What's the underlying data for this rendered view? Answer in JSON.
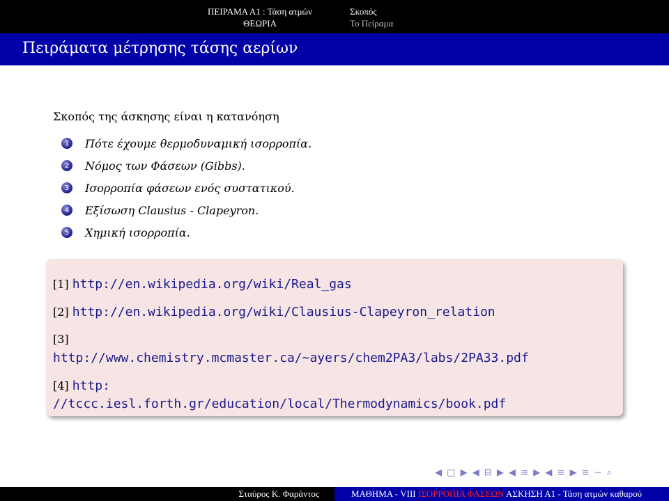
{
  "header": {
    "section_title": "ΠΕΙΡΑΜΑ Α1 : Τάση ατμών",
    "section_subtitle": "ΘΕΩΡΙΑ",
    "subsection_title": "Σκοπός",
    "subsection_subtitle": "Το Πείραμα"
  },
  "frame": {
    "title": "Πειράματα μέτρησης τάσης αερίων"
  },
  "content": {
    "intro": "Σκοπός της άσκησης είναι η κατανόηση",
    "items": [
      {
        "num": "1",
        "text": "Πότε έχουμε θερμοδυναμική ισορροπία."
      },
      {
        "num": "2",
        "text": "Νόμος των Φάσεων (Gibbs)."
      },
      {
        "num": "3",
        "text": "Ισορροπία φάσεων ενός συστατικού."
      },
      {
        "num": "4",
        "text": "Εξίσωση Clausius - Clapeyron."
      },
      {
        "num": "5",
        "text": "Χημική ισορροπία."
      }
    ]
  },
  "references": [
    {
      "label": "[1]",
      "url": "http://en.wikipedia.org/wiki/Real_gas"
    },
    {
      "label": "[2]",
      "url": "http://en.wikipedia.org/wiki/Clausius-Clapeyron_relation"
    },
    {
      "label": "[3]",
      "url": "http://www.chemistry.mcmaster.ca/~ayers/chem2PA3/labs/2PA33.pdf"
    },
    {
      "label": "[4]",
      "url_part1": "http:",
      "url_part2": "//tccc.iesl.forth.gr/education/local/Thermodynamics/book.pdf"
    }
  ],
  "navigation": {
    "prev": "◀",
    "next": "▶",
    "frame_icon": "□",
    "subsection_icon": "⊟",
    "section_icon": "≡",
    "zoom_icon": "∽",
    "search_icon": "⌕"
  },
  "footer": {
    "author": "Σταύρος Κ. Φαράντος",
    "course": "ΜΑΘΗΜΑ - VIII",
    "topic": "ΙΣΟΡΡΟΠΙΑ ΦΑΣΕΩΝ",
    "exercise": "ΑΣΚΗΣΗ Α1 - Τάση ατμών καθαρού"
  },
  "colors": {
    "title_bar": "#0000a8",
    "header_bar": "#000000",
    "ref_block": "#f7e4e4",
    "footer_highlight": "#ff2020"
  }
}
